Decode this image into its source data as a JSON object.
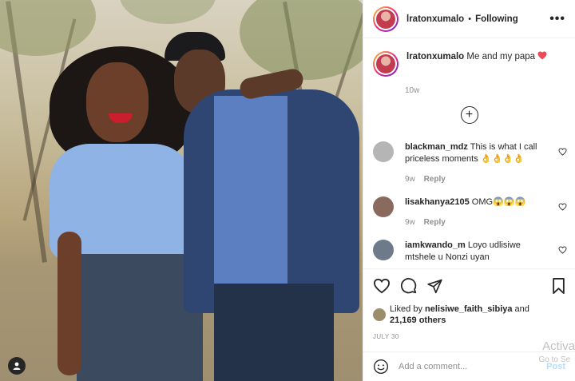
{
  "post": {
    "username": "lratonxumalo",
    "follow_status": "Following",
    "separator": "•",
    "more_label": "•••"
  },
  "caption": {
    "username": "lratonxumalo",
    "text": "Me and my papa",
    "time_ago": "10w"
  },
  "load_more_label": "+",
  "comments": [
    {
      "username": "blackman_mdz",
      "text": "This is what I call priceless moments 👌👌👌👌",
      "time": "9w",
      "reply": "Reply",
      "avatar_color": "#b5b5b5"
    },
    {
      "username": "lisakhanya2105",
      "text": "OMG😱😱😱",
      "time": "9w",
      "reply": "Reply",
      "avatar_color": "#8a6a5e"
    },
    {
      "username": "iamkwando_m",
      "text": "Loyo udlisiwe mtshele u Nonzi uyan",
      "time": "",
      "reply": "",
      "avatar_color": "#6c7a8a"
    }
  ],
  "likes": {
    "prefix": "Liked by",
    "user": "nelisiwe_faith_sibiya",
    "middle": "and",
    "count": "21,169 others"
  },
  "date": "JULY 30",
  "add_comment": {
    "placeholder": "Add a comment...",
    "post_label": "Post"
  },
  "watermark": {
    "line1": "Activa",
    "line2": "Go to Se"
  },
  "colors": {
    "heart_red": "#ed4956",
    "post_blue": "#b2dffc",
    "muted": "#8e8e8e"
  },
  "icons": [
    "user-tag-icon",
    "more-options-icon",
    "load-more-icon",
    "heart-icon",
    "comment-icon",
    "share-icon",
    "bookmark-icon",
    "emoji-icon"
  ]
}
